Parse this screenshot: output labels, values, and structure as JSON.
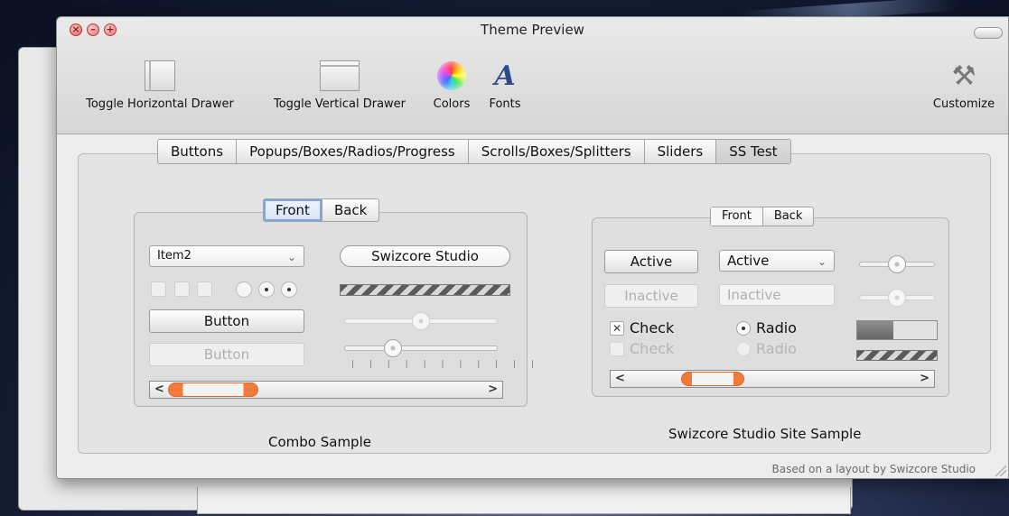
{
  "window": {
    "title": "Theme Preview",
    "traffic": {
      "close": "×",
      "minimize": "–",
      "zoom": "+"
    }
  },
  "toolbar": {
    "items": [
      {
        "label": "Toggle Horizontal Drawer",
        "icon": "horizontal-drawer-icon"
      },
      {
        "label": "Toggle Vertical Drawer",
        "icon": "vertical-drawer-icon"
      },
      {
        "label": "Colors",
        "icon": "color-wheel-icon"
      },
      {
        "label": "Fonts",
        "icon": "fonts-icon",
        "glyph": "A"
      },
      {
        "label": "Customize",
        "icon": "tools-icon",
        "glyph": "⚒"
      }
    ]
  },
  "tabs": {
    "items": [
      "Buttons",
      "Popups/Boxes/Radios/Progress",
      "Scrolls/Boxes/Splitters",
      "Sliders",
      "SS Test"
    ],
    "selected": "SS Test"
  },
  "combo_sample": {
    "segment": [
      "Front",
      "Back"
    ],
    "selected_segment": "Front",
    "combo_value": "Item2",
    "combo_arrow": "⌄",
    "search_field": "Swizcore Studio",
    "button_label": "Button",
    "button_disabled_label": "Button",
    "ticks": "| | | | | | | | | | |",
    "scroll_left": "<",
    "scroll_right": ">",
    "caption": "Combo Sample"
  },
  "site_sample": {
    "segment": [
      "Front",
      "Back"
    ],
    "selected_segment": "Front",
    "active_button": "Active",
    "active_popup": "Active",
    "popup_arrow": "⌄",
    "inactive_button": "Inactive",
    "inactive_popup": "Inactive",
    "check_label": "Check",
    "check_mark": "✕",
    "check_disabled_label": "Check",
    "radio_label": "Radio",
    "radio_disabled_label": "Radio",
    "progress_fraction": 0.46,
    "scroll_left": "<",
    "scroll_right": ">",
    "caption": "Swizcore Studio Site Sample"
  },
  "footer": {
    "text": "Based on a layout by Swizcore Studio"
  },
  "colors": {
    "accent_orange": "#f07a3a",
    "focus_blue": "#7ea7e2"
  }
}
